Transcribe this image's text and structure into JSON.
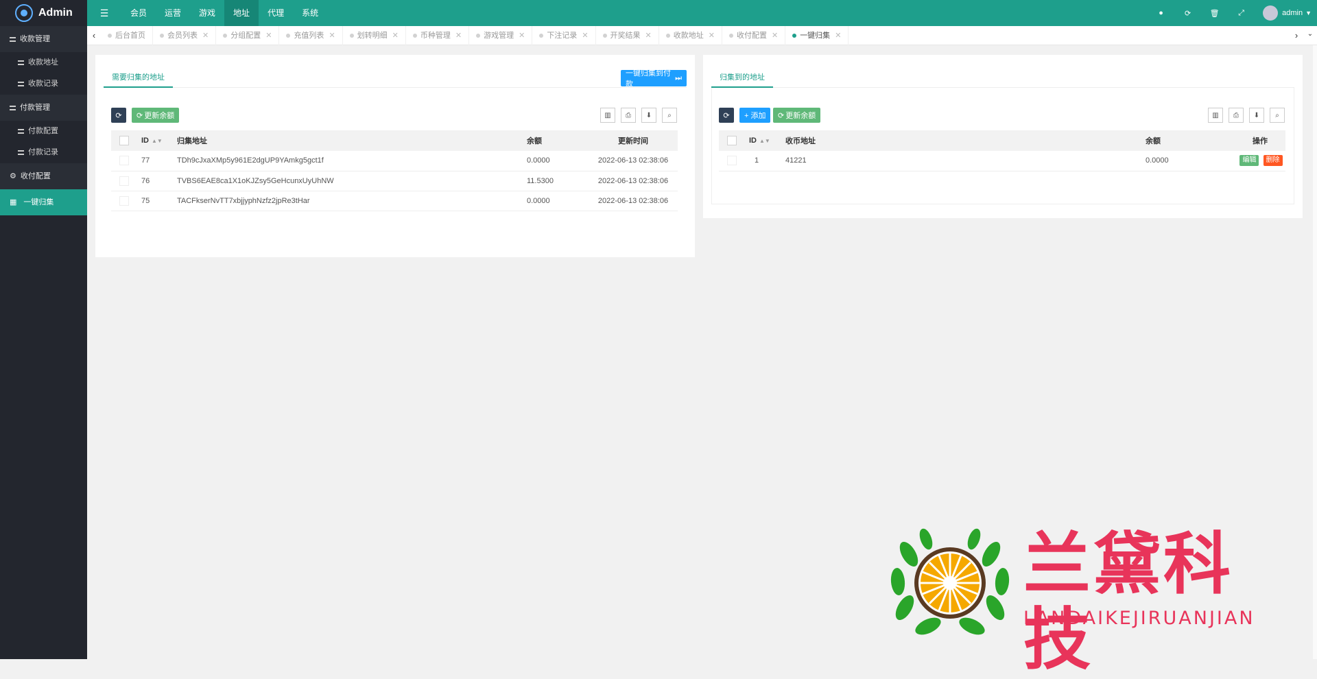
{
  "topbar": {
    "logo_text": "Admin",
    "menu_toggle_icon": "menu-icon",
    "nav": [
      "会员",
      "运营",
      "游戏",
      "地址",
      "代理",
      "系统"
    ],
    "active_nav_index": 3,
    "icons": [
      "theme-icon",
      "refresh-icon",
      "trash-icon",
      "fullscreen-icon"
    ],
    "user": "admin"
  },
  "sidebar": {
    "groups": [
      {
        "label": "收款管理",
        "items": [
          "收款地址",
          "收款记录"
        ]
      },
      {
        "label": "付款管理",
        "items": [
          "付款配置",
          "付款记录"
        ]
      }
    ],
    "single": "收付配置",
    "active": "一键归集"
  },
  "tabs": {
    "items": [
      "后台首页",
      "会员列表",
      "分组配置",
      "充值列表",
      "划转明细",
      "币种管理",
      "游戏管理",
      "下注记录",
      "开奖结果",
      "收款地址",
      "收付配置",
      "一键归集"
    ],
    "active_index": 11
  },
  "left_panel": {
    "tab": "需要归集的地址",
    "action_button": "一键归集到付款",
    "refresh_label": "更新余额",
    "columns": [
      "ID",
      "归集地址",
      "余额",
      "更新时间"
    ],
    "rows": [
      {
        "id": "77",
        "address": "TDh9cJxaXMp5y961E2dgUP9YAmkg5gct1f",
        "balance": "0.0000",
        "time": "2022-06-13 02:38:06"
      },
      {
        "id": "76",
        "address": "TVBS6EAE8ca1X1oKJZsy5GeHcunxUyUhNW",
        "balance": "11.5300",
        "time": "2022-06-13 02:38:06"
      },
      {
        "id": "75",
        "address": "TACFkserNvTT7xbjjyphNzfz2jpRe3tHar",
        "balance": "0.0000",
        "time": "2022-06-13 02:38:06"
      }
    ]
  },
  "right_panel": {
    "tab": "归集到的地址",
    "add_label": "+ 添加",
    "refresh_label": "更新余额",
    "columns": [
      "ID",
      "收币地址",
      "余额",
      "操作"
    ],
    "rows": [
      {
        "id": "1",
        "address": "41221",
        "balance": "0.0000",
        "edit": "编辑",
        "delete": "删除"
      }
    ]
  },
  "watermark": {
    "title": "兰黛科技",
    "subtitle": "LANDAIKEJIRUANJIAN"
  },
  "colors": {
    "primary": "#1e9f8c",
    "sidebar": "#23262e",
    "blue": "#1e9fff",
    "green": "#5fb878",
    "red": "#ff5722",
    "brand_pink": "#e8345a"
  }
}
